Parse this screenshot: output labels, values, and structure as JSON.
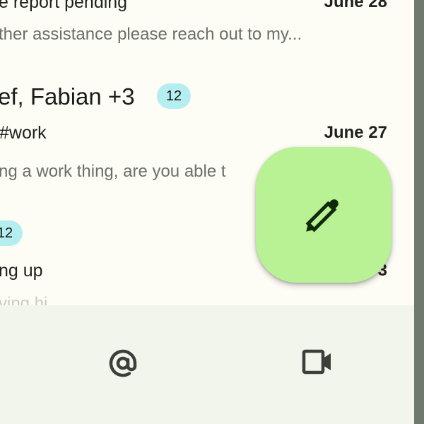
{
  "emails": [
    {
      "subject": "e report pending",
      "date": "June 28",
      "snippet": "ther assistance please reach out to my..."
    },
    {
      "sender": "ef, Fabian +3",
      "badge": "12",
      "subject": "#work",
      "date": "June 27",
      "snippet": "ng a work thing, are you able t"
    },
    {
      "badge": "12",
      "subject": "ng up",
      "date": "3",
      "snippet": "ving hi"
    }
  ],
  "bottom_nav": [
    {
      "icon": "at-sign-icon"
    },
    {
      "icon": "video-camera-icon"
    }
  ],
  "fab": {
    "icon": "pencil-icon"
  },
  "colors": {
    "background": "#fdfdf6",
    "badge": "#b4eef0",
    "fab": "#b8f294",
    "bottom_bar": "#f2f5ec",
    "scroll_edge": "#6f7a6c"
  }
}
